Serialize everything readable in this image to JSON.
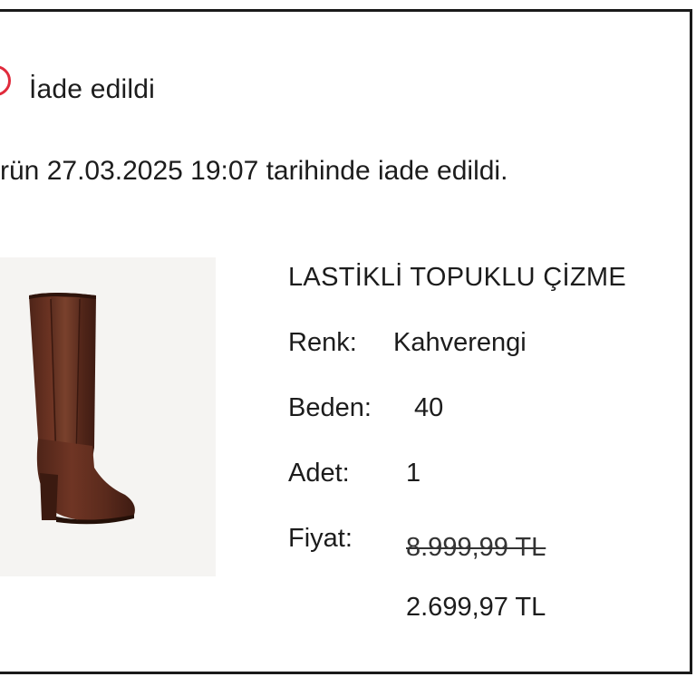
{
  "status": {
    "title": "İade edildi",
    "message": "rün 27.03.2025 19:07 tarihinde iade edildi.",
    "color": "#e02b3c"
  },
  "product": {
    "name": "LASTİKLİ TOPUKLU ÇİZME",
    "color_label": "Renk:",
    "color_value": "Kahverengi",
    "size_label": "Beden:",
    "size_value": "40",
    "qty_label": "Adet:",
    "qty_value": "1",
    "price_label": "Fiyat:",
    "old_price": "8.999,99 TL",
    "new_price": "2.699,97 TL",
    "image_icon": "brown-knee-high-boot"
  }
}
